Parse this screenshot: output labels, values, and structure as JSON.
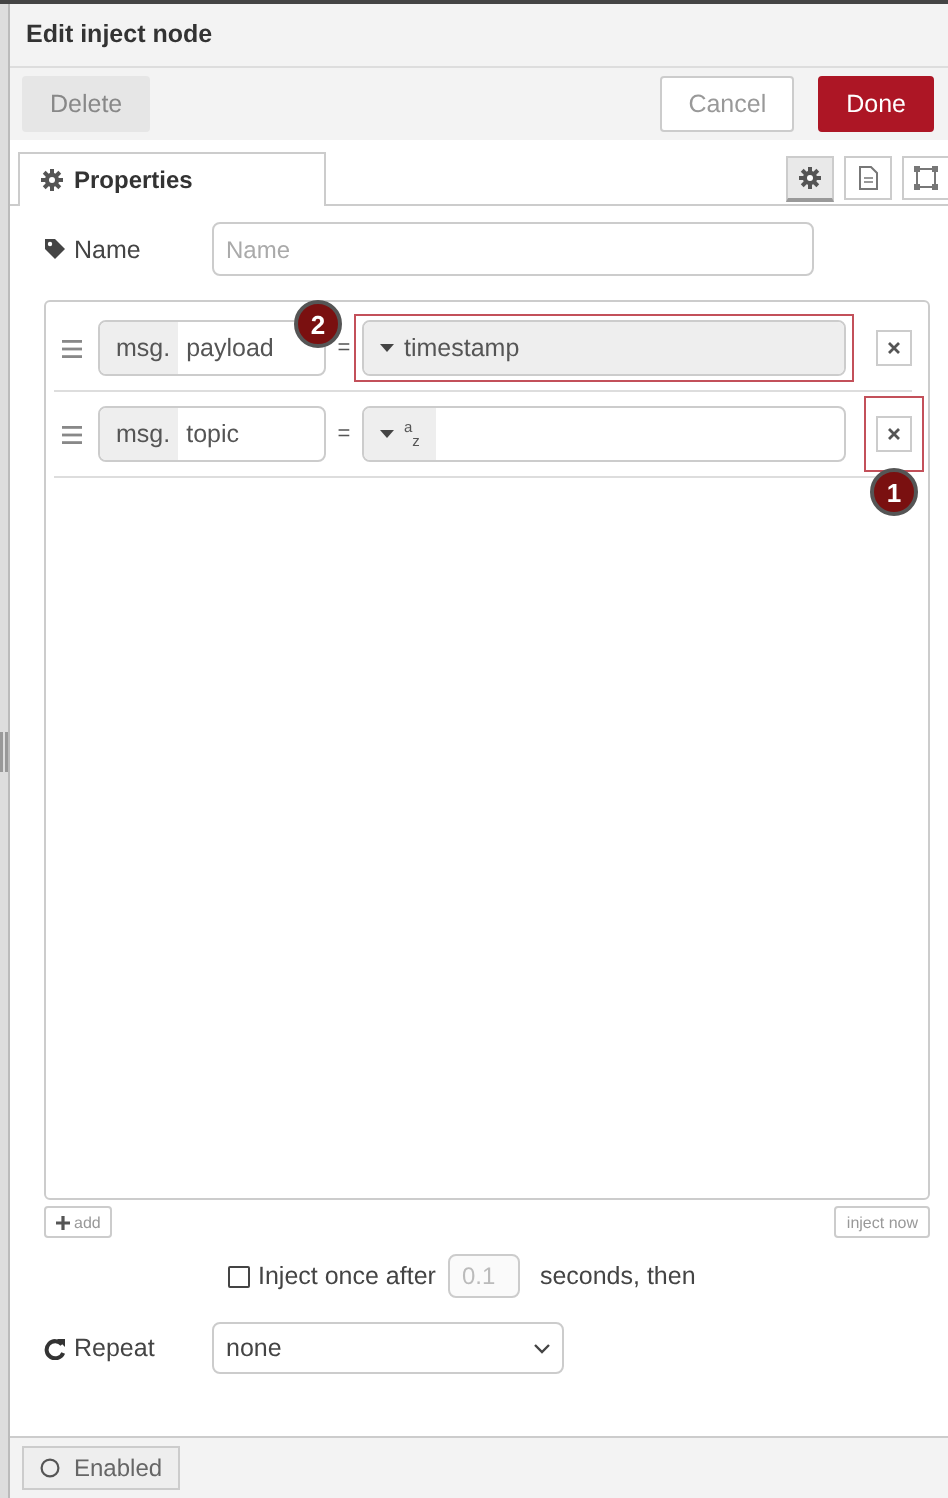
{
  "tray": {
    "title": "Edit inject node",
    "buttons": [
      {
        "label": "Delete",
        "kind": "secondary"
      },
      {
        "label": "Cancel",
        "kind": "plain"
      },
      {
        "label": "Done",
        "kind": "primary"
      }
    ]
  },
  "tabs": [
    {
      "label": "Properties",
      "selected": true
    }
  ],
  "icon_tabs": [
    {
      "kind": "gear",
      "selected": true
    },
    {
      "kind": "document",
      "selected": false
    },
    {
      "kind": "frame",
      "selected": false
    }
  ],
  "name_field": {
    "label": "Name",
    "placeholder": "Name"
  },
  "properties": [
    {
      "prefix": "msg.",
      "property": "payload",
      "equals": "=",
      "kind": "timestamp",
      "type_label": "timestamp",
      "type_annotation": "2"
    },
    {
      "prefix": "msg.",
      "property": "topic",
      "equals": "=",
      "kind": "str",
      "type_glyph": "$^{a}$$_{z}$",
      "delete_annotation": "1"
    }
  ],
  "list_buttons": {
    "add": "add",
    "inject_now": "inject now"
  },
  "inject_once": {
    "checked": false,
    "label": "Inject once after",
    "delay": "0.1",
    "delay_disabled": true,
    "suffix": "seconds, then"
  },
  "repeat": {
    "label": "Repeat",
    "value": "none"
  },
  "footer": {
    "label": "Enabled"
  }
}
